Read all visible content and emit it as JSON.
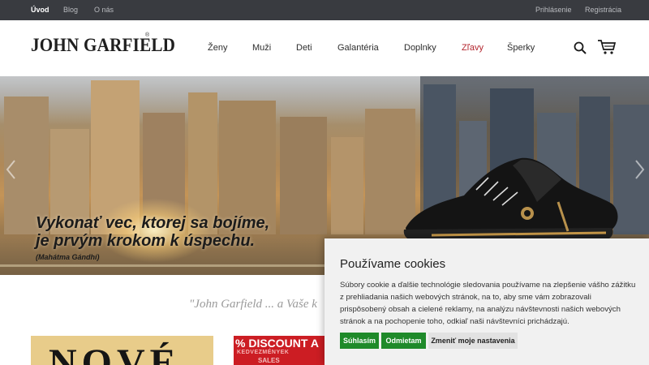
{
  "topbar": {
    "left_links": [
      "Úvod",
      "Blog",
      "O nás"
    ],
    "right_links": [
      "Prihlásenie",
      "Registrácia"
    ]
  },
  "header": {
    "logo": "JOHN GARFIELD",
    "logo_mark": "®",
    "nav": [
      "Ženy",
      "Muži",
      "Deti",
      "Galantéria",
      "Doplnky",
      "Zľavy",
      "Šperky"
    ],
    "search_icon": "search-icon",
    "cart_icon": "cart-icon"
  },
  "hero": {
    "quote_line1": "Vykonať vec, ktorej sa bojíme,",
    "quote_line2": "je prvým krokom k úspechu.",
    "quote_author": "(Mahátma Gándhí)"
  },
  "tagline": "\"John Garfield ... a Vaše k",
  "cards": {
    "nove": "NOVÉ",
    "discount_main": "% DISCOUNT A",
    "discount_sub": "KEDVEZMÉNYEK",
    "discount_sub2": "SALES"
  },
  "cookie": {
    "title": "Používame cookies",
    "text": "Súbory cookie a ďalšie technológie sledovania používame na zlepšenie vášho zážitku z prehliadania našich webových stránok, na to, aby sme vám zobrazovali prispôsobený obsah a cielené reklamy, na analýzu návštevnosti našich webových stránok a na pochopenie toho, odkiaľ naši návštevníci prichádzajú.",
    "accept": "Súhlasím",
    "reject": "Odmietam",
    "settings": "Zmeniť moje nastavenia"
  },
  "colors": {
    "topbar_bg": "#393b40",
    "sale_nav": "#b3262e",
    "cookie_button": "#1f8a2a",
    "discount_red": "#cc1d23"
  }
}
